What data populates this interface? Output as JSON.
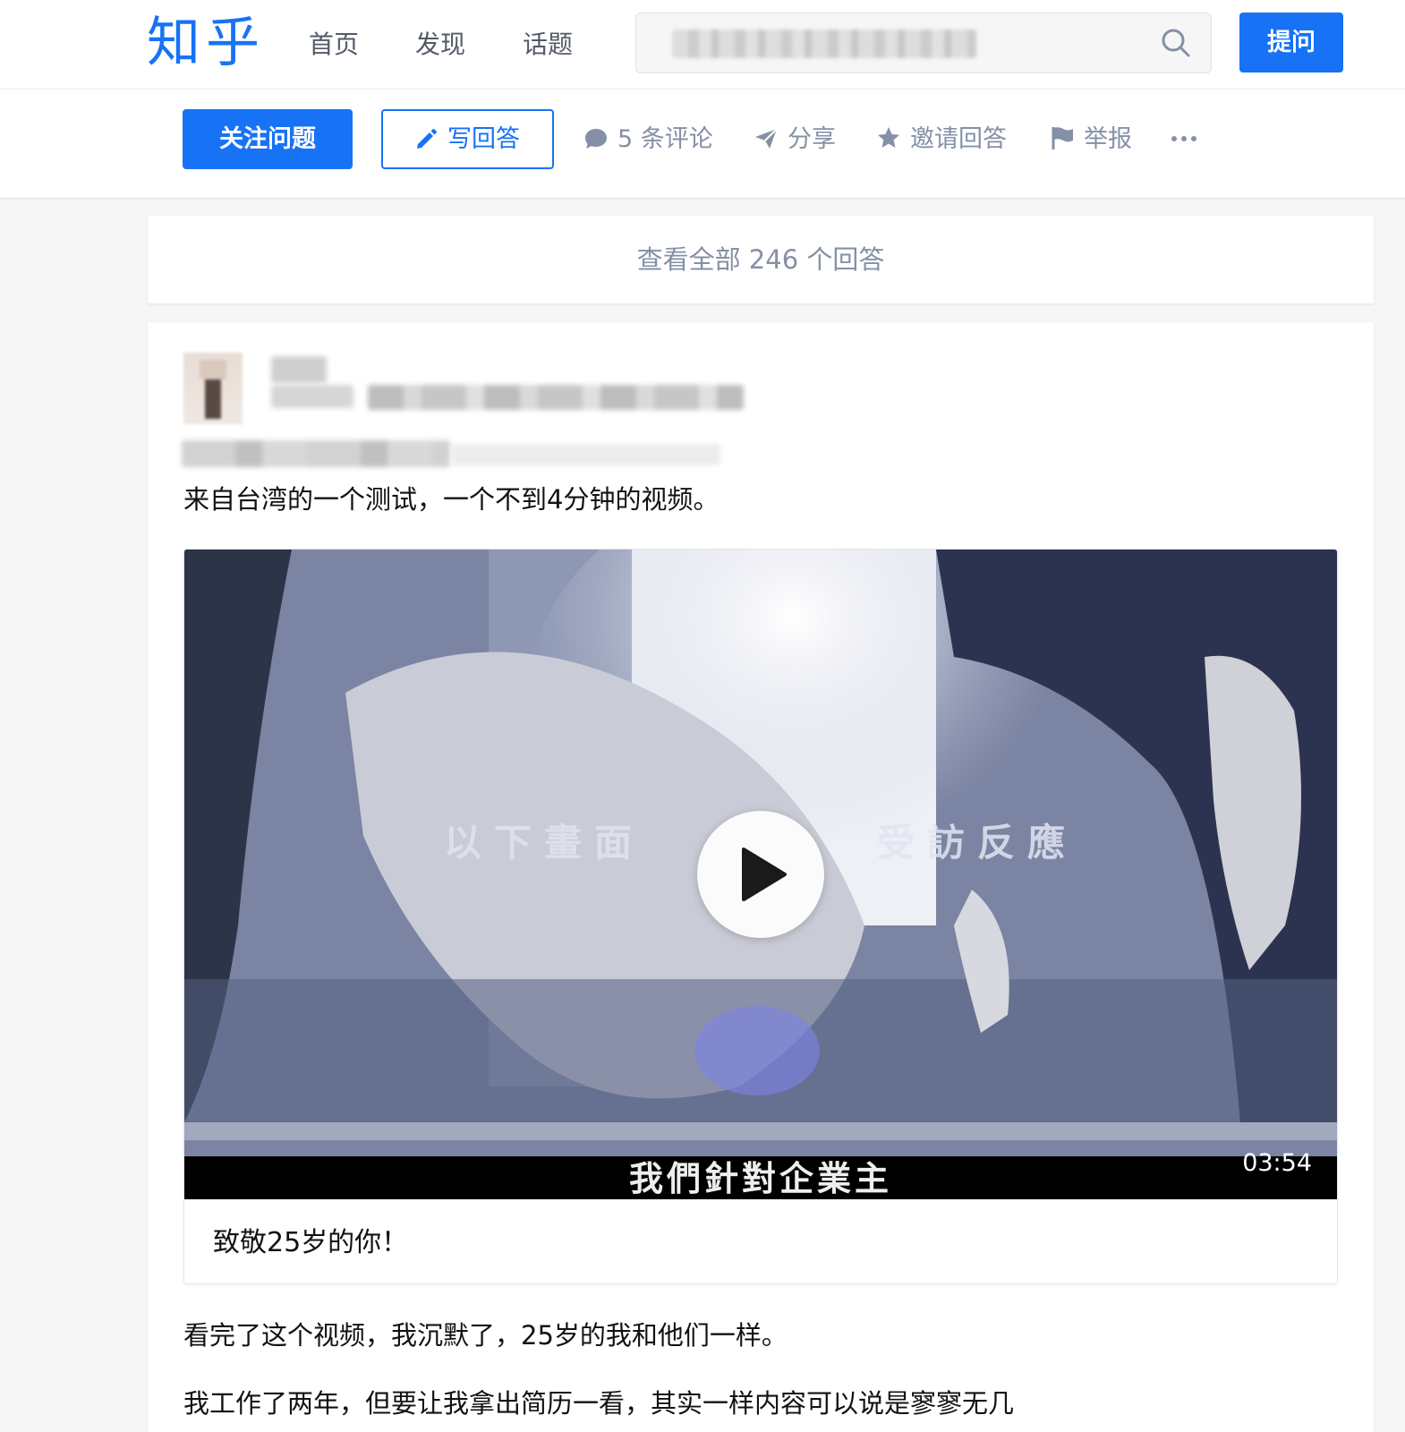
{
  "header": {
    "logo": "知乎",
    "nav": [
      "首页",
      "发现",
      "话题"
    ],
    "search": {
      "placeholder": ""
    },
    "ask_label": "提问"
  },
  "question_bar": {
    "follow_label": "关注问题",
    "write_label": "写回答",
    "comments_label": "5 条评论",
    "share_label": "分享",
    "invite_label": "邀请回答",
    "report_label": "举报"
  },
  "view_all_label": "查看全部 246 个回答",
  "answer": {
    "intro": "来自台湾的一个测试，一个不到4分钟的视频。",
    "video": {
      "title": "致敬25岁的你！",
      "duration": "03:54",
      "caption_mid": "以下畫面",
      "caption_mid_right": "受訪反應",
      "caption_bottom": "我們針對企業主"
    },
    "paragraph_1": "看完了这个视频，我沉默了，25岁的我和他们一样。",
    "paragraph_2": "我工作了两年，但要让我拿出简历一看，其实一样内容可以说是寥寥无几"
  },
  "colors": {
    "brand": "#1772f6",
    "muted": "#8590a6",
    "nav": "#535a66"
  }
}
